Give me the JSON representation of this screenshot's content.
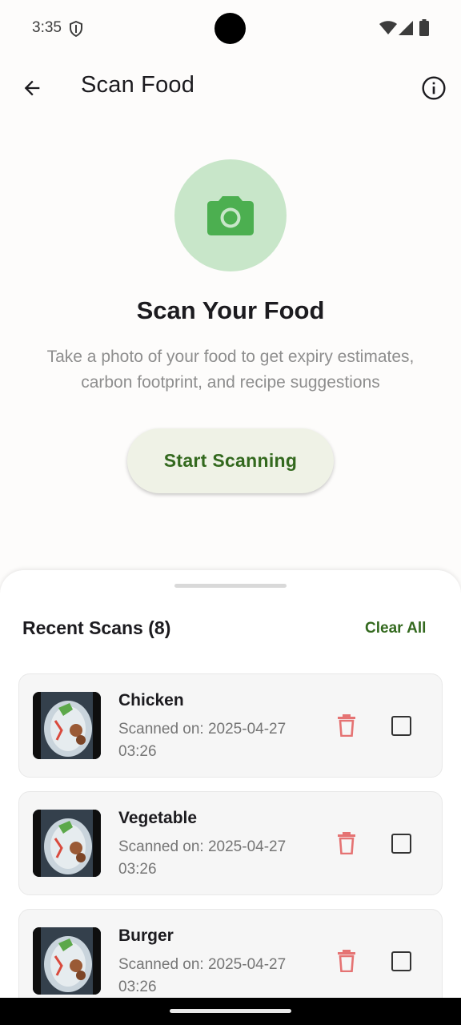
{
  "status": {
    "time": "3:35"
  },
  "app_bar": {
    "title": "Scan Food"
  },
  "hero": {
    "title": "Scan Your Food",
    "subtitle": "Take a photo of your food to get expiry estimates, carbon footprint, and recipe suggestions",
    "button_label": "Start Scanning"
  },
  "recent": {
    "title": "Recent Scans (8)",
    "clear_label": "Clear All",
    "items": [
      {
        "name": "Chicken",
        "date": "Scanned on: 2025-04-27 03:26",
        "checked": false
      },
      {
        "name": "Vegetable",
        "date": "Scanned on: 2025-04-27 03:26",
        "checked": false
      },
      {
        "name": "Burger",
        "date": "Scanned on: 2025-04-27 03:26",
        "checked": false
      }
    ]
  },
  "icons": [
    "back-arrow-icon",
    "info-icon",
    "camera-icon",
    "trash-icon",
    "shield-icon",
    "wifi-icon",
    "signal-icon",
    "battery-icon"
  ],
  "colors": {
    "accent_green": "#33691e",
    "camera_green": "#4caf50",
    "hero_circle": "#c8e6c9",
    "delete_red": "#e57373"
  }
}
